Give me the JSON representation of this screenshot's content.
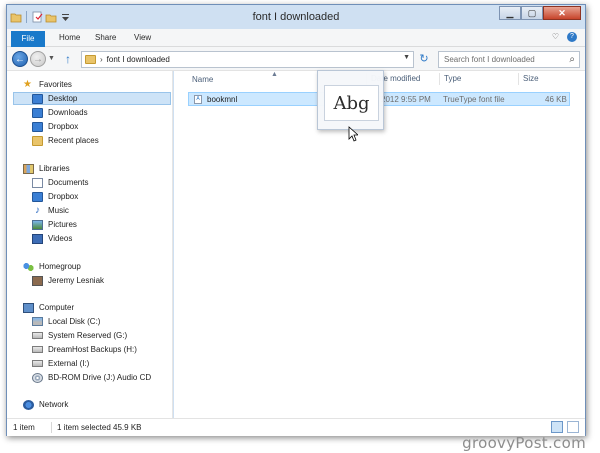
{
  "window": {
    "title": "font I downloaded"
  },
  "ribbon": {
    "tabs": [
      "File",
      "Home",
      "Share",
      "View"
    ]
  },
  "address": {
    "path": "font I downloaded",
    "search_placeholder": "Search font I downloaded"
  },
  "nav": {
    "favorites_label": "Favorites",
    "favorites": [
      "Desktop",
      "Downloads",
      "Dropbox",
      "Recent places"
    ],
    "libraries_label": "Libraries",
    "libraries": [
      "Documents",
      "Dropbox",
      "Music",
      "Pictures",
      "Videos"
    ],
    "homegroup_label": "Homegroup",
    "homegroup": [
      "Jeremy Lesniak"
    ],
    "computer_label": "Computer",
    "computer": [
      "Local Disk (C:)",
      "System Reserved (G:)",
      "DreamHost Backups (H:)",
      "External (I:)",
      "BD-ROM Drive (J:) Audio CD"
    ],
    "network_label": "Network"
  },
  "columns": [
    "Name",
    "Date modified",
    "Type",
    "Size"
  ],
  "files": [
    {
      "name": "bookmnl",
      "date": "2012 9:55 PM",
      "type": "TrueType font file",
      "size": "46 KB"
    }
  ],
  "preview": {
    "sample": "Abg"
  },
  "status": {
    "count": "1 item",
    "selected": "1 item selected  45.9 KB"
  },
  "watermark": "groovyPost.com"
}
